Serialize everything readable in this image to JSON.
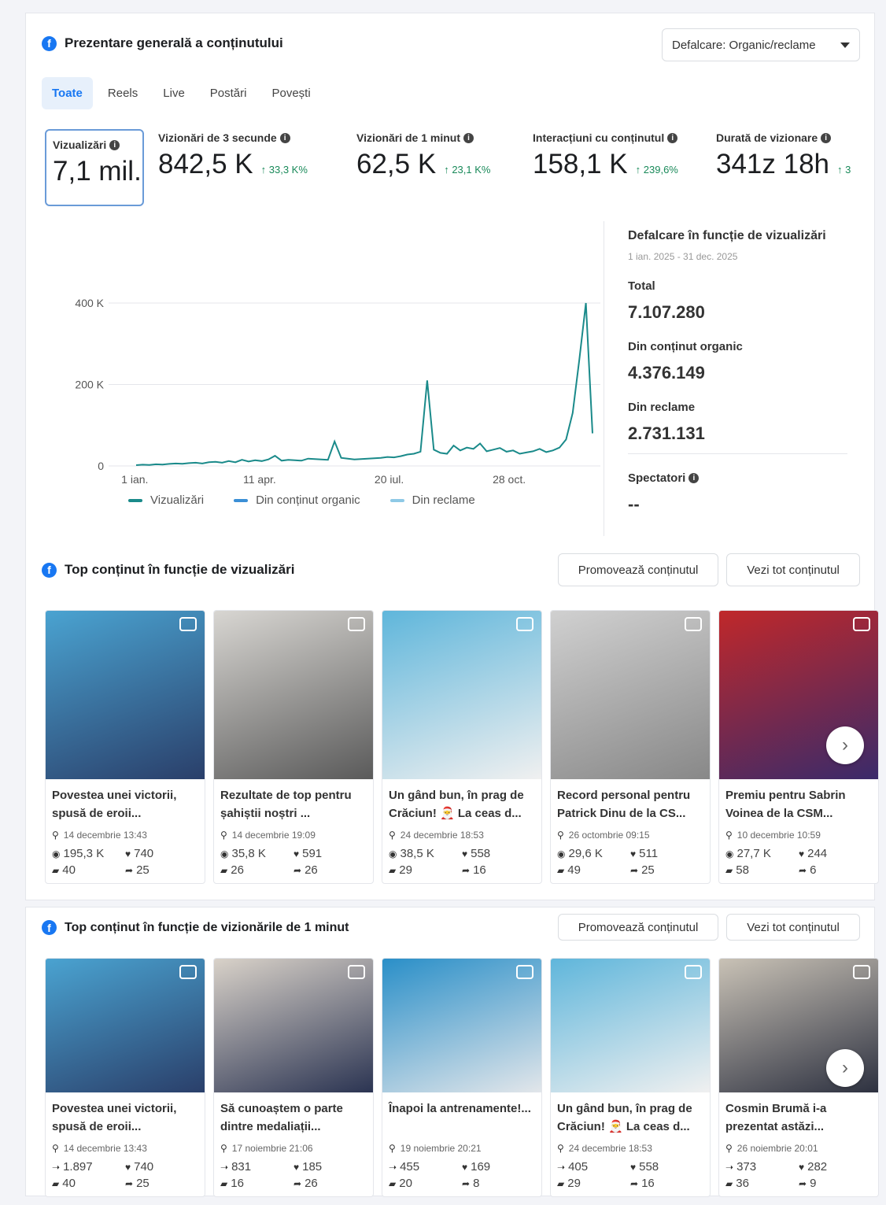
{
  "overview": {
    "title": "Prezentare generală a conținutului",
    "dropdown": "Defalcare: Organic/reclame",
    "tabs": [
      "Toate",
      "Reels",
      "Live",
      "Postări",
      "Povești"
    ],
    "metrics": [
      {
        "label": "Vizualizări",
        "value": "7,1 mil.",
        "change": ""
      },
      {
        "label": "Vizionări de 3 secunde",
        "value": "842,5 K",
        "change": "↑ 33,3 K%"
      },
      {
        "label": "Vizionări de 1 minut",
        "value": "62,5 K",
        "change": "↑ 23,1 K%"
      },
      {
        "label": "Interacțiuni cu conținutul",
        "value": "158,1 K",
        "change": "↑ 239,6%"
      },
      {
        "label": "Durată de vizionare",
        "value": "341z 18h",
        "change": "↑ 3"
      }
    ]
  },
  "chart_data": {
    "type": "line",
    "x_ticks": [
      "1 ian.",
      "11 apr.",
      "20 iul.",
      "28 oct."
    ],
    "y_ticks": [
      "400 K",
      "200 K",
      "0"
    ],
    "ylim": [
      0,
      400000
    ],
    "series": [
      {
        "name": "Vizualizări",
        "color": "#1a8a8a",
        "values": [
          2000,
          3000,
          2500,
          4000,
          3500,
          5000,
          6000,
          5500,
          7000,
          8000,
          6000,
          9000,
          10000,
          8000,
          12000,
          9000,
          15000,
          11000,
          14000,
          12000,
          16000,
          25000,
          13000,
          15000,
          14000,
          13000,
          18000,
          17000,
          16000,
          15000,
          60000,
          20000,
          18000,
          16000,
          17000,
          18000,
          19000,
          20000,
          22000,
          21000,
          24000,
          28000,
          30000,
          35000,
          210000,
          40000,
          32000,
          30000,
          50000,
          38000,
          45000,
          42000,
          55000,
          36000,
          40000,
          44000,
          35000,
          38000,
          30000,
          33000,
          36000,
          42000,
          34000,
          38000,
          45000,
          65000,
          130000,
          260000,
          400000,
          80000
        ]
      },
      {
        "name": "Din conținut organic",
        "color": "#3b8fd6",
        "values": []
      },
      {
        "name": "Din reclame",
        "color": "#8ec9e6",
        "values": []
      }
    ]
  },
  "breakdown": {
    "title": "Defalcare în funcție de vizualizări",
    "date": "1 ian. 2025 - 31 dec. 2025",
    "total_label": "Total",
    "total_value": "7.107.280",
    "organic_label": "Din conținut organic",
    "organic_value": "4.376.149",
    "ads_label": "Din reclame",
    "ads_value": "2.731.131",
    "viewers_label": "Spectatori",
    "viewers_value": "--"
  },
  "top_views": {
    "title": "Top conținut în funcție de vizualizări",
    "promote": "Promovează conținutul",
    "see_all": "Vezi tot conținutul",
    "cards": [
      {
        "title": "Povestea unei victorii, spusă de eroii...",
        "date": "14 decembrie 13:43",
        "views": "195,3 K",
        "likes": "740",
        "comments": "40",
        "shares": "25"
      },
      {
        "title": "Rezultate de top pentru șahiștii noștri ...",
        "date": "14 decembrie 19:09",
        "views": "35,8 K",
        "likes": "591",
        "comments": "26",
        "shares": "26"
      },
      {
        "title": "Un gând bun, în prag de Crăciun! 🎅 La ceas d...",
        "date": "24 decembrie 18:53",
        "views": "38,5 K",
        "likes": "558",
        "comments": "29",
        "shares": "16"
      },
      {
        "title": "Record personal pentru Patrick Dinu de la CS...",
        "date": "26 octombrie 09:15",
        "views": "29,6 K",
        "likes": "511",
        "comments": "49",
        "shares": "25"
      },
      {
        "title": "Premiu pentru Sabrin Voinea de la CSM...",
        "date": "10 decembrie 10:59",
        "views": "27,7 K",
        "likes": "244",
        "comments": "58",
        "shares": "6"
      }
    ]
  },
  "top_minute": {
    "title": "Top conținut în funcție de vizionările de 1 minut",
    "promote": "Promovează conținutul",
    "see_all": "Vezi tot conținutul",
    "cards": [
      {
        "title": "Povestea unei victorii, spusă de eroii...",
        "date": "14 decembrie 13:43",
        "views": "1.897",
        "likes": "740",
        "comments": "40",
        "shares": "25"
      },
      {
        "title": "Să cunoaștem o parte dintre medaliații...",
        "date": "17 noiembrie 21:06",
        "views": "831",
        "likes": "185",
        "comments": "16",
        "shares": "26"
      },
      {
        "title": "Înapoi la antrenamente!...",
        "date": "19 noiembrie 20:21",
        "views": "455",
        "likes": "169",
        "comments": "20",
        "shares": "8"
      },
      {
        "title": "Un gând bun, în prag de Crăciun! 🎅 La ceas d...",
        "date": "24 decembrie 18:53",
        "views": "405",
        "likes": "558",
        "comments": "29",
        "shares": "16"
      },
      {
        "title": "Cosmin Brumă i-a prezentat astăzi...",
        "date": "26 noiembrie 20:01",
        "views": "373",
        "likes": "282",
        "comments": "36",
        "shares": "9"
      }
    ]
  }
}
